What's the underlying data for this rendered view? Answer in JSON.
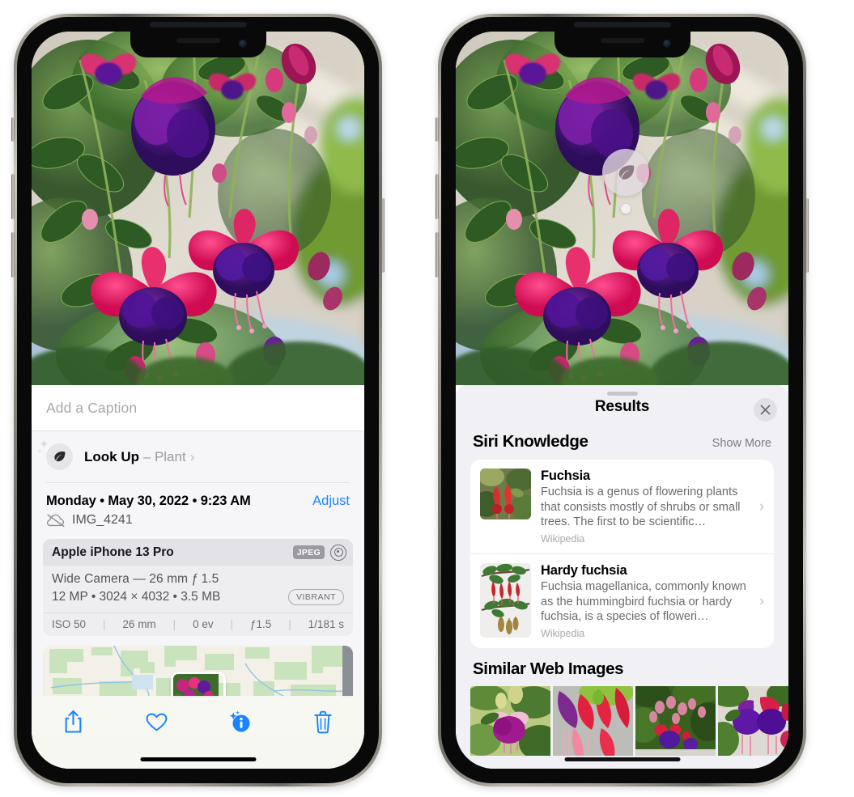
{
  "left_phone": {
    "name": "photos-detail-view",
    "photo": {
      "alt": "fuchsia-flowers-photo"
    },
    "caption": {
      "placeholder": "Add a Caption",
      "value": ""
    },
    "look_up": {
      "icon": "leaf-icon",
      "label": "Look Up",
      "dash": "–",
      "subject": "Plant",
      "chevron": "›"
    },
    "meta": {
      "date": "Monday • May 30, 2022 • 9:23 AM",
      "adjust_label": "Adjust",
      "cloud_icon": "cloud-slash-icon",
      "filename": "IMG_4241"
    },
    "camera_card": {
      "device": "Apple iPhone 13 Pro",
      "format_badge": "JPEG",
      "raw_icon": "aperture-icon",
      "lens_line": "Wide Camera — 26 mm ƒ 1.5",
      "specs_line": "12 MP • 3024 × 4032 • 3.5 MB",
      "style_badge": "VIBRANT",
      "exif": [
        "ISO 50",
        "26 mm",
        "0 ev",
        "ƒ1.5",
        "1/181 s"
      ],
      "exif_separator": "|"
    },
    "map": {
      "alt": "location-map-strip",
      "thumb_alt": "photo-location-thumbnail"
    },
    "toolbar": [
      {
        "name": "share-button",
        "icon": "share-icon"
      },
      {
        "name": "favorite-button",
        "icon": "heart-icon"
      },
      {
        "name": "info-button",
        "icon": "info-sparkle-icon"
      },
      {
        "name": "delete-button",
        "icon": "trash-icon"
      }
    ],
    "accent_color": "#1a84ff"
  },
  "right_phone": {
    "name": "visual-look-up-results",
    "photo": {
      "alt": "fuchsia-flowers-photo"
    },
    "vlu_badge": {
      "icon": "leaf-icon",
      "name": "visual-look-up-badge"
    },
    "panel": {
      "title": "Results",
      "close_icon": "close-icon",
      "grabber": "drag-handle"
    },
    "siri_knowledge": {
      "title": "Siri Knowledge",
      "action": "Show More",
      "cards": [
        {
          "title": "Fuchsia",
          "snippet": "Fuchsia is a genus of flowering plants that consists mostly of shrubs or small trees. The first to be scientific…",
          "source": "Wikipedia",
          "thumb_alt": "fuchsia-flower-thumbnail",
          "chevron": "›"
        },
        {
          "title": "Hardy fuchsia",
          "snippet": "Fuchsia magellanica, commonly known as the hummingbird fuchsia or hardy fuchsia, is a species of floweri…",
          "source": "Wikipedia",
          "thumb_alt": "hardy-fuchsia-thumbnail",
          "chevron": "›"
        }
      ]
    },
    "similar_web_images": {
      "title": "Similar Web Images",
      "images": [
        {
          "alt": "magenta-fuchsia-web-image-1"
        },
        {
          "alt": "red-fuchsia-web-image-2"
        },
        {
          "alt": "fuchsia-bush-web-image-3"
        },
        {
          "alt": "purple-fuchsia-web-image-4"
        }
      ]
    }
  }
}
